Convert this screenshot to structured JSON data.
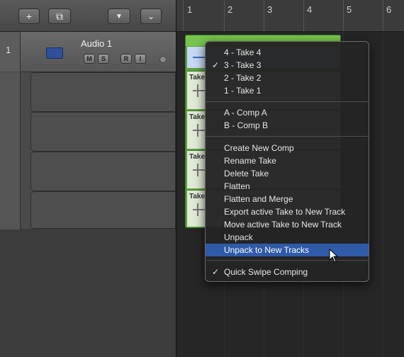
{
  "toolbar": {
    "add_label": "+",
    "global_tracks_label": "⧉",
    "filter_label": "▼",
    "collapse_label": "⌄"
  },
  "track": {
    "number": "1",
    "name": "Audio 1",
    "buttons": [
      "M",
      "S",
      "R",
      "I"
    ]
  },
  "ruler": {
    "bars": [
      "1",
      "2",
      "3",
      "4",
      "5",
      "6"
    ]
  },
  "region": {
    "take_label": "Take"
  },
  "menu": {
    "items": [
      {
        "label": "4 - Take 4",
        "checked": false
      },
      {
        "label": "3 - Take 3",
        "checked": true
      },
      {
        "label": "2 - Take 2",
        "checked": false
      },
      {
        "label": "1 - Take 1",
        "checked": false
      },
      {
        "label": "A - Comp A",
        "checked": false
      },
      {
        "label": "B - Comp B",
        "checked": false
      },
      {
        "label": "Create New Comp",
        "checked": false
      },
      {
        "label": "Rename Take",
        "checked": false
      },
      {
        "label": "Delete Take",
        "checked": false
      },
      {
        "label": "Flatten",
        "checked": false
      },
      {
        "label": "Flatten and Merge",
        "checked": false
      },
      {
        "label": "Export active Take to New Track",
        "checked": false
      },
      {
        "label": "Move active Take to New Track",
        "checked": false
      },
      {
        "label": "Unpack",
        "checked": false
      },
      {
        "label": "Unpack to New Tracks",
        "checked": false,
        "highlighted": true
      },
      {
        "label": "Quick Swipe Comping",
        "checked": true
      }
    ],
    "check_glyph": "✓"
  },
  "colors": {
    "region_green": "#5ca33e",
    "menu_highlight": "#2f5aa8"
  }
}
